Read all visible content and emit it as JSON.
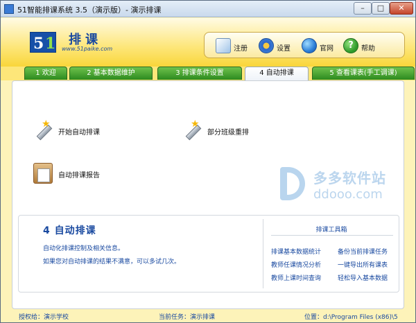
{
  "window": {
    "title": "51智能排课系统 3.5（演示版）- 演示排课",
    "controls": {
      "minimize": "–",
      "maximize": "□",
      "close": "✕"
    }
  },
  "header": {
    "logo_digit_1": "5",
    "logo_digit_2": "1",
    "logo_name": "排课",
    "logo_url": "www.51paike.com",
    "toolbar": [
      {
        "label": "注册",
        "icon": "register-icon"
      },
      {
        "label": "设置",
        "icon": "gear-icon"
      },
      {
        "label": "官网",
        "icon": "globe-icon"
      },
      {
        "label": "帮助",
        "icon": "help-icon",
        "glyph": "?"
      }
    ]
  },
  "tabs": [
    {
      "label": "1 欢迎",
      "active": false
    },
    {
      "label": "2 基本数据维护",
      "active": false
    },
    {
      "label": "3 排课条件设置",
      "active": false
    },
    {
      "label": "4 自动排课",
      "active": true
    },
    {
      "label": "5 查看课表(手工调课)",
      "active": false
    }
  ],
  "actions": [
    {
      "label": "开始自动排课",
      "icon": "magic-wand-icon"
    },
    {
      "label": "部分班级重排",
      "icon": "magic-wand-icon"
    },
    {
      "label": "自动排课报告",
      "icon": "clipboard-icon"
    }
  ],
  "watermark": {
    "cn": "多多软件站",
    "en": "ddooo.com"
  },
  "info": {
    "title": "4  自动排课",
    "line1": "自动化排课控制及相关信息。",
    "line2": "如果您对自动排课的结果不满意，可以多试几次。"
  },
  "toolbox": {
    "title": "排课工具箱",
    "links": [
      "排课基本数据统计",
      "备份当前排课任务",
      "教师任课情况分析",
      "一键导出所有课表",
      "教师上课时间查询",
      "轻松导入基本数据"
    ]
  },
  "status": {
    "license": "授权给：演示学校",
    "task": "当前任务：演示排课",
    "location": "位置：d:\\Program Files (x86)\\5"
  },
  "colors": {
    "header_yellow": "#fde679",
    "tab_green": "#2c8a1f",
    "link_blue": "#1a4aa0",
    "logo_blue": "#1650a8"
  }
}
